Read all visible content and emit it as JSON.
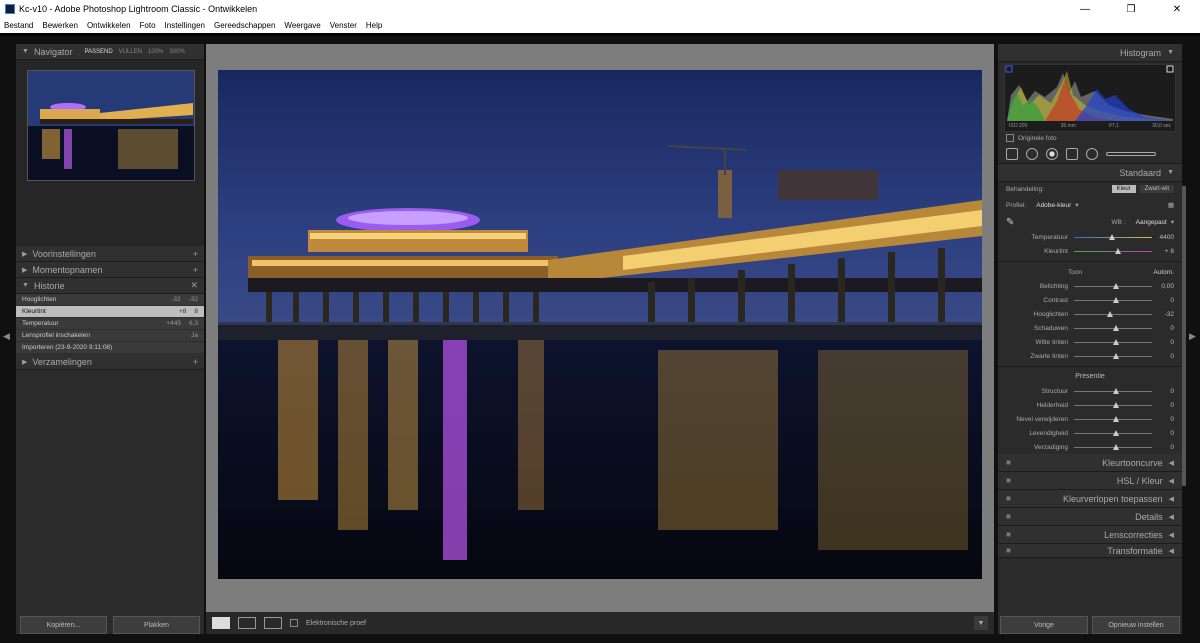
{
  "window": {
    "title": "Kc-v10 - Adobe Photoshop Lightroom Classic - Ontwikkelen",
    "minimize": "—",
    "maximize": "❐",
    "close": "✕"
  },
  "menu": [
    "Bestand",
    "Bewerken",
    "Ontwikkelen",
    "Foto",
    "Instellingen",
    "Gereedschappen",
    "Weergave",
    "Venster",
    "Help"
  ],
  "left_panel": {
    "navigator": {
      "title": "Navigator",
      "zoom_options": [
        "PASSEND",
        "VULLEN",
        "100%",
        "300%"
      ]
    },
    "presets": "Voorinstellingen",
    "snapshots": "Momentopnamen",
    "history": {
      "title": "Historie",
      "items": [
        {
          "label": "Hooglichten",
          "value_a": "-32",
          "value_b": "-32"
        },
        {
          "label": "Kleurtint",
          "value_a": "+8",
          "value_b": "8"
        },
        {
          "label": "Temperatuur",
          "value_a": "+445",
          "value_b": "6,3"
        },
        {
          "label": "Lensprofiel inschakelen",
          "value_a": "",
          "value_b": "Ja"
        },
        {
          "label": "Importeren (23-9-2020 9:11:08)",
          "value_a": "",
          "value_b": ""
        }
      ],
      "active_index": 1
    },
    "collections": "Verzamelingen",
    "copy_button": "Kopiëren...",
    "paste_button": "Plakken"
  },
  "toolbar": {
    "soft_proof_label": "Elektronische proef"
  },
  "right_panel": {
    "histogram": {
      "title": "Histogram",
      "values": [
        "ISO 200",
        "35 mm",
        "f/7,1",
        "30,0 sec"
      ],
      "original_photo": "Originele foto"
    },
    "basic": {
      "title": "Standaard",
      "treatment_label": "Behandeling:",
      "treatment_options": [
        "Kleur",
        "Zwart-wit"
      ],
      "profile_label": "Profiel:",
      "profile_value": "Adobe-kleur",
      "wb_label": "WB :",
      "wb_value": "Aangepast",
      "temp_label": "Temperatuur",
      "temp_value": "4400",
      "tint_label": "Kleurtint",
      "tint_value": "+ 8",
      "tone_label": "Toon",
      "auto_label": "Autom.",
      "sliders": [
        {
          "label": "Belichting",
          "value": "0,00",
          "pos": 0.5
        },
        {
          "label": "Contrast",
          "value": "0",
          "pos": 0.5
        },
        {
          "label": "Hooglichten",
          "value": "-32",
          "pos": 0.42
        },
        {
          "label": "Schaduwen",
          "value": "0",
          "pos": 0.5
        },
        {
          "label": "Witte tinten",
          "value": "0",
          "pos": 0.5
        },
        {
          "label": "Zwarte tinten",
          "value": "0",
          "pos": 0.5
        }
      ],
      "presence_label": "Presentie",
      "presence": [
        {
          "label": "Structuur",
          "value": "0",
          "pos": 0.5
        },
        {
          "label": "Helderheid",
          "value": "0",
          "pos": 0.5
        },
        {
          "label": "Nevel verwijderen",
          "value": "0",
          "pos": 0.5
        },
        {
          "label": "Levendigheid",
          "value": "0",
          "pos": 0.5
        },
        {
          "label": "Verzadiging",
          "value": "0",
          "pos": 0.5
        }
      ]
    },
    "sections": [
      "Kleurtooncurve",
      "HSL / Kleur",
      "Kleurverlopen toepassen",
      "Details",
      "Lenscorrecties",
      "Transformatie"
    ],
    "previous_button": "Vorige",
    "reset_button": "Opnieuw instellen"
  }
}
